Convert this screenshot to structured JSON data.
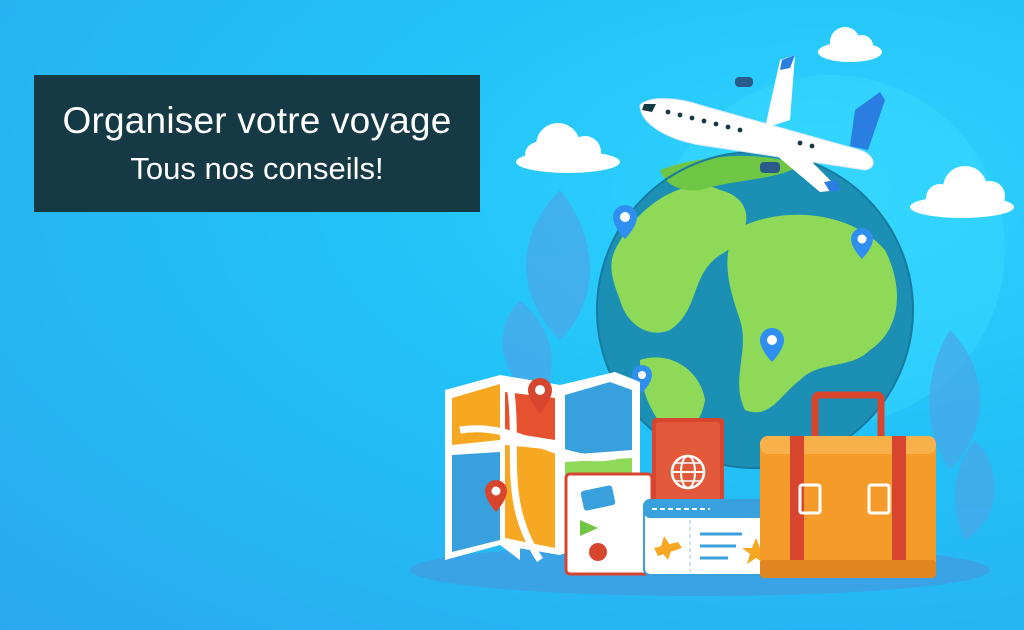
{
  "banner": {
    "title_line1": "Organiser votre voyage",
    "title_line2": "Tous nos conseils!"
  },
  "colors": {
    "background": "#2cc0f6",
    "title_box": "#163a45",
    "title_text": "#ffffff",
    "ocean": "#1c8fb5",
    "land": "#8ed957",
    "suitcase": "#f49b2a",
    "passport": "#d7452f"
  },
  "icons": [
    "airplane-icon",
    "globe-icon",
    "map-pin-icon",
    "folded-map-icon",
    "passport-icon",
    "boarding-pass-icon",
    "suitcase-icon",
    "cloud-icon"
  ]
}
